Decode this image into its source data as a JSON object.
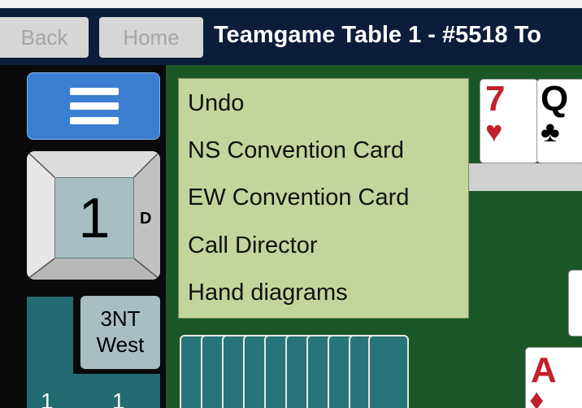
{
  "header": {
    "back_label": "Back",
    "home_label": "Home",
    "title": "Teamgame Table 1 - #5518 To"
  },
  "board": {
    "number": "1",
    "dealer": "D"
  },
  "contract": {
    "level": "3NT",
    "declarer": "West"
  },
  "tricks": {
    "left": "1",
    "right": "1"
  },
  "played_cards": [
    {
      "rank": "7",
      "suit": "♥",
      "color": "#c2202a"
    },
    {
      "rank": "Q",
      "suit": "♣",
      "color": "#000000"
    },
    {
      "rank": "A",
      "suit": "♦",
      "color": "#c2202a"
    }
  ],
  "menu": {
    "items": [
      "Undo",
      "NS Convention Card",
      "EW Convention Card",
      "Call Director",
      "Hand diagrams"
    ]
  },
  "colors": {
    "table_felt": "#1b5726",
    "header_bg": "#0c1d3c",
    "menu_button": "#3c7fd2",
    "popup_bg": "#c3d59c",
    "card_back": "#27757b"
  },
  "icons": {
    "menu": "hamburger-icon"
  }
}
